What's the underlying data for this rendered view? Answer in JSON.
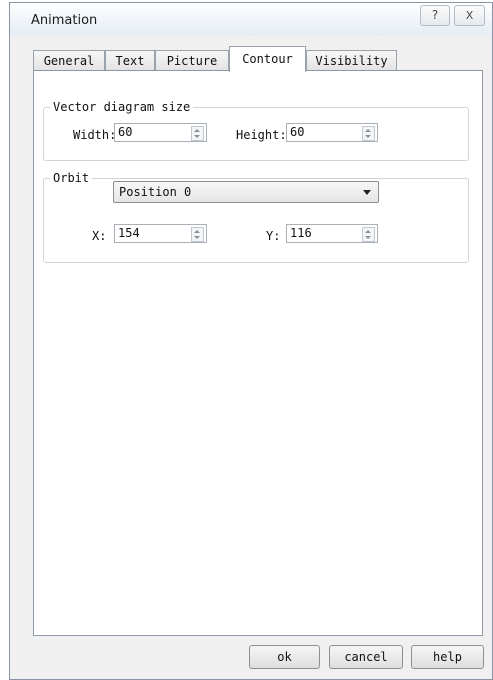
{
  "window": {
    "title": "Animation",
    "help_glyph": "?",
    "close_glyph": "X"
  },
  "tabs": [
    {
      "label": "General"
    },
    {
      "label": "Text"
    },
    {
      "label": "Picture"
    },
    {
      "label": "Contour"
    },
    {
      "label": "Visibility"
    }
  ],
  "active_tab": "Contour",
  "vector_size": {
    "legend": "Vector diagram size",
    "width_label": "Width:",
    "width_value": "60",
    "height_label": "Height:",
    "height_value": "60"
  },
  "orbit": {
    "legend": "Orbit",
    "selected": "Position 0",
    "x_label": "X:",
    "x_value": "154",
    "y_label": "Y:",
    "y_value": "116"
  },
  "buttons": {
    "ok": "ok",
    "cancel": "cancel",
    "help": "help"
  }
}
